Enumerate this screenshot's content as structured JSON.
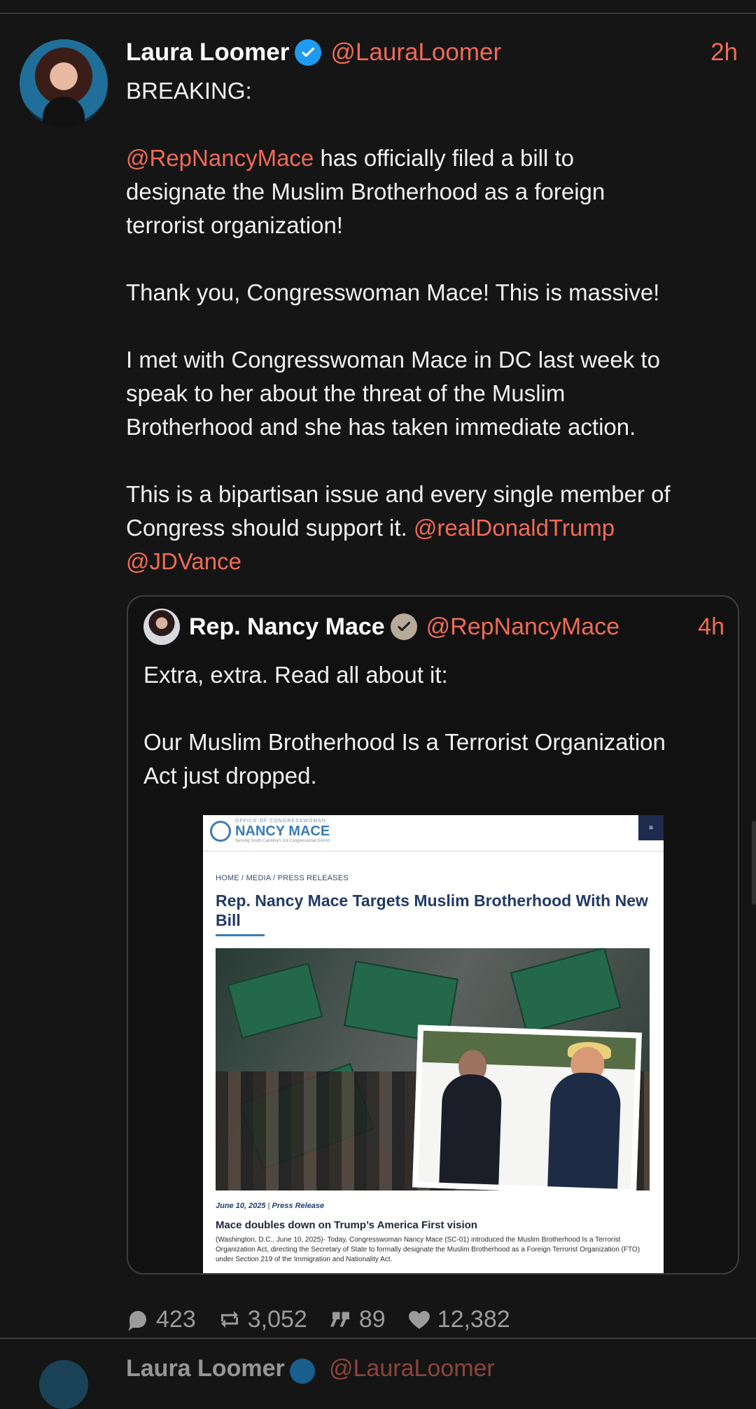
{
  "post": {
    "name": "Laura Loomer",
    "handle": "@LauraLoomer",
    "time": "2h",
    "paragraphs": [
      [
        "BREAKING:"
      ],
      [],
      [
        {
          "mention": "@RepNancyMace"
        },
        " has officially filed a bill to"
      ],
      [
        "designate the Muslim Brotherhood as a foreign"
      ],
      [
        "terrorist organization!"
      ],
      [],
      [
        "Thank you, Congresswoman Mace! This is massive!"
      ],
      [],
      [
        "I met with Congresswoman Mace in DC last week to"
      ],
      [
        "speak to her about the threat of the Muslim"
      ],
      [
        "Brotherhood and she has taken immediate action."
      ],
      [],
      [
        "This is a bipartisan issue and every single member of"
      ],
      [
        "Congress should support it. ",
        {
          "mention": "@realDonaldTrump"
        }
      ],
      [
        {
          "mention": "@JDVance"
        }
      ]
    ],
    "colors": {
      "accent": "#f06b57",
      "background": "#151515",
      "verified_blue": "#1d9bf0",
      "verified_gold": "#b8aa9a"
    }
  },
  "quote": {
    "name": "Rep. Nancy Mace",
    "handle": "@RepNancyMace",
    "time": "4h",
    "text_lines": [
      "Extra, extra. Read all about it:",
      "",
      "Our Muslim Brotherhood Is a Terrorist Organization",
      "Act just dropped."
    ],
    "media": {
      "logo_small": "OFFICE OF CONGRESSWOMAN",
      "logo_big": "NANCY MACE",
      "logo_sub": "Serving South Carolina's 1st Congressional District",
      "menu_icon": "≡",
      "breadcrumb": "HOME  /  MEDIA  /  PRESS RELEASES",
      "headline": "Rep. Nancy Mace Targets Muslim Brotherhood With New Bill",
      "date": "June 10, 2025",
      "date_separator": "|",
      "date_label": "Press Release",
      "subheadline": "Mace doubles down on Trump’s America First vision",
      "body": "(Washington, D.C., June 10, 2025)- Today, Congresswoman Nancy Mace (SC-01) introduced the Muslim Brotherhood Is a Terrorist Organization Act, directing the Secretary of State to formally designate the Muslim Brotherhood as a Foreign Terrorist Organization (FTO) under Section 219 of the Immigration and Nationality Act."
    }
  },
  "actions": {
    "replies": "423",
    "reposts": "3,052",
    "quotes": "89",
    "likes": "12,382"
  },
  "next_post": {
    "name": "Laura Loomer",
    "handle": "@LauraLoomer"
  },
  "icons": {
    "reply": "reply-icon",
    "repost": "repost-icon",
    "quote": "quote-icon",
    "like": "heart-icon",
    "verified": "verified-badge-icon",
    "check": "check-icon"
  }
}
